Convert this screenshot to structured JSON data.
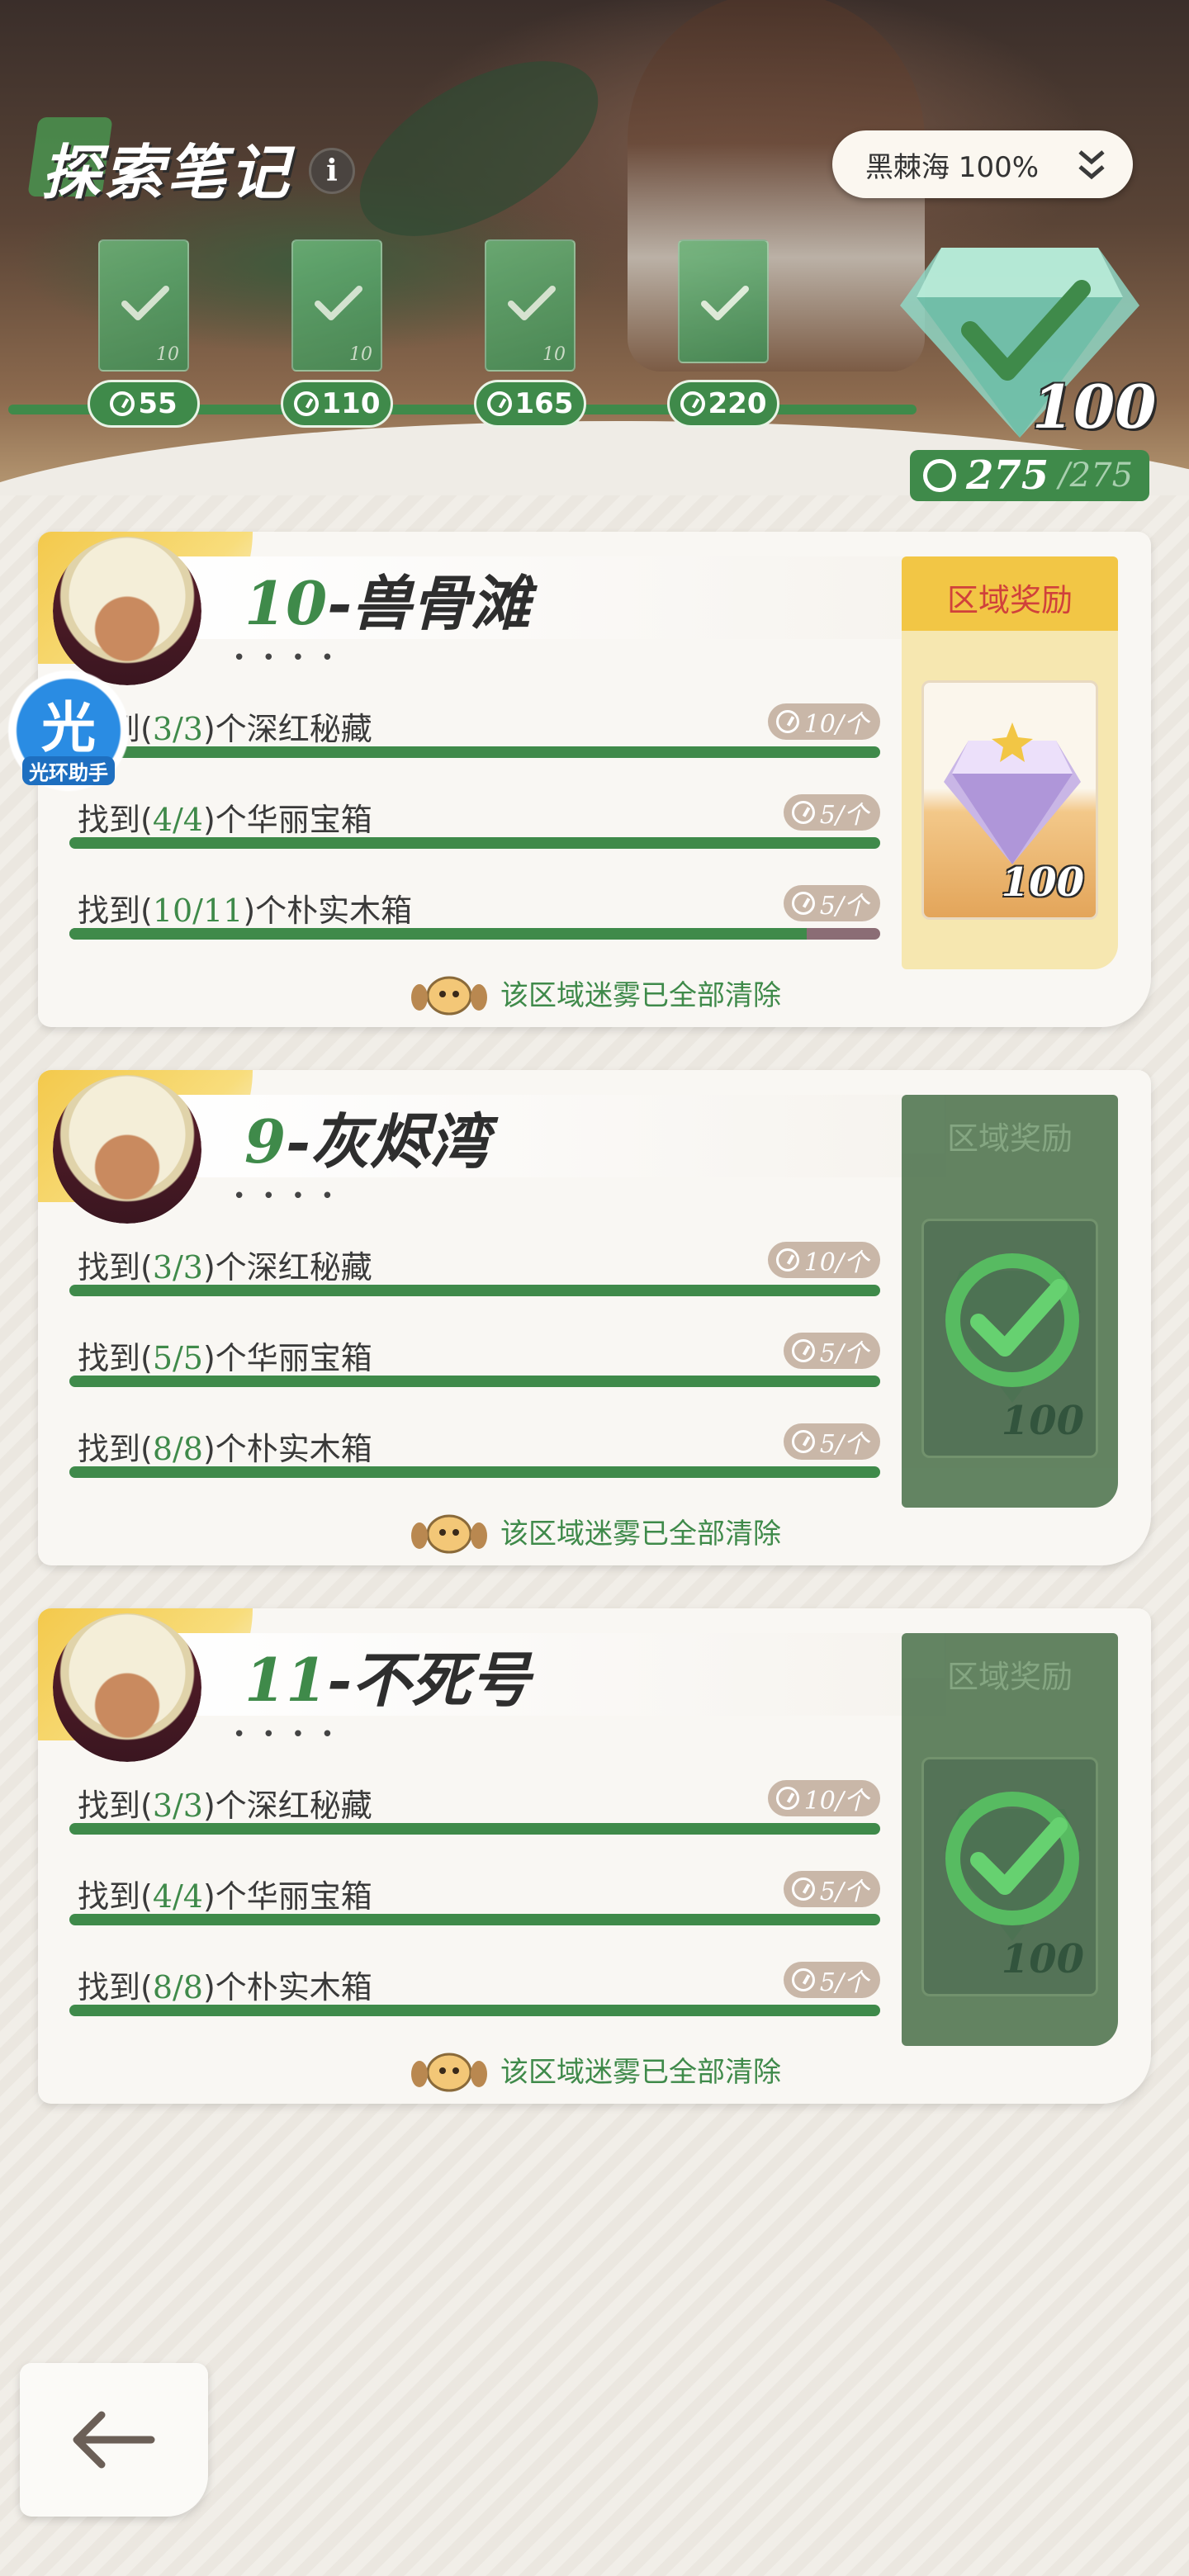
{
  "header": {
    "title": "探索笔记",
    "info_icon": "i",
    "region_select": "黑棘海 100%"
  },
  "milestones": [
    {
      "points": "55",
      "num": "10"
    },
    {
      "points": "110",
      "num": "10"
    },
    {
      "points": "165",
      "num": "10"
    },
    {
      "points": "220",
      "num": ""
    }
  ],
  "total": {
    "reward_num": "100",
    "value": "275",
    "max": "/275"
  },
  "cards": [
    {
      "number": "10",
      "name": "-兽骨滩",
      "dots": "• • • •",
      "reward_title": "区域奖励",
      "reward_num": "100",
      "reward_state": "unclaimed",
      "footer": "该区域迷雾已全部清除",
      "tasks": [
        {
          "prefix": "找到(",
          "count": "3/3",
          "suffix": ")个深红秘藏",
          "reward": "10/个",
          "progress": 1.0
        },
        {
          "prefix": "找到(",
          "count": "4/4",
          "suffix": ")个华丽宝箱",
          "reward": "5/个",
          "progress": 1.0
        },
        {
          "prefix": "找到(",
          "count": "10/11",
          "suffix": ")个朴实木箱",
          "reward": "5/个",
          "progress": 0.909
        }
      ]
    },
    {
      "number": "9",
      "name": "-灰烬湾",
      "dots": "• • • •",
      "reward_title": "区域奖励",
      "reward_num": "100",
      "reward_state": "claimed",
      "footer": "该区域迷雾已全部清除",
      "tasks": [
        {
          "prefix": "找到(",
          "count": "3/3",
          "suffix": ")个深红秘藏",
          "reward": "10/个",
          "progress": 1.0
        },
        {
          "prefix": "找到(",
          "count": "5/5",
          "suffix": ")个华丽宝箱",
          "reward": "5/个",
          "progress": 1.0
        },
        {
          "prefix": "找到(",
          "count": "8/8",
          "suffix": ")个朴实木箱",
          "reward": "5/个",
          "progress": 1.0
        }
      ]
    },
    {
      "number": "11",
      "name": "-不死号",
      "dots": "• • • •",
      "reward_title": "区域奖励",
      "reward_num": "100",
      "reward_state": "claimed",
      "footer": "该区域迷雾已全部清除",
      "tasks": [
        {
          "prefix": "找到(",
          "count": "3/3",
          "suffix": ")个深红秘藏",
          "reward": "10/个",
          "progress": 1.0
        },
        {
          "prefix": "找到(",
          "count": "4/4",
          "suffix": ")个华丽宝箱",
          "reward": "5/个",
          "progress": 1.0
        },
        {
          "prefix": "找到(",
          "count": "8/8",
          "suffix": ")个朴实木箱",
          "reward": "5/个",
          "progress": 1.0
        }
      ]
    }
  ],
  "assistant": {
    "glyph": "光",
    "label": "光环助手"
  },
  "icons": {
    "back": "back-arrow-icon",
    "chevron": "double-chevron-down-icon",
    "coin": "stopwatch-coin-icon",
    "check": "check-icon",
    "gem": "gem-icon",
    "mascot": "mascot-icon"
  },
  "colors": {
    "accent_green": "#3f8a4a",
    "reward_red": "#d0413b",
    "gold": "#f2c645"
  }
}
